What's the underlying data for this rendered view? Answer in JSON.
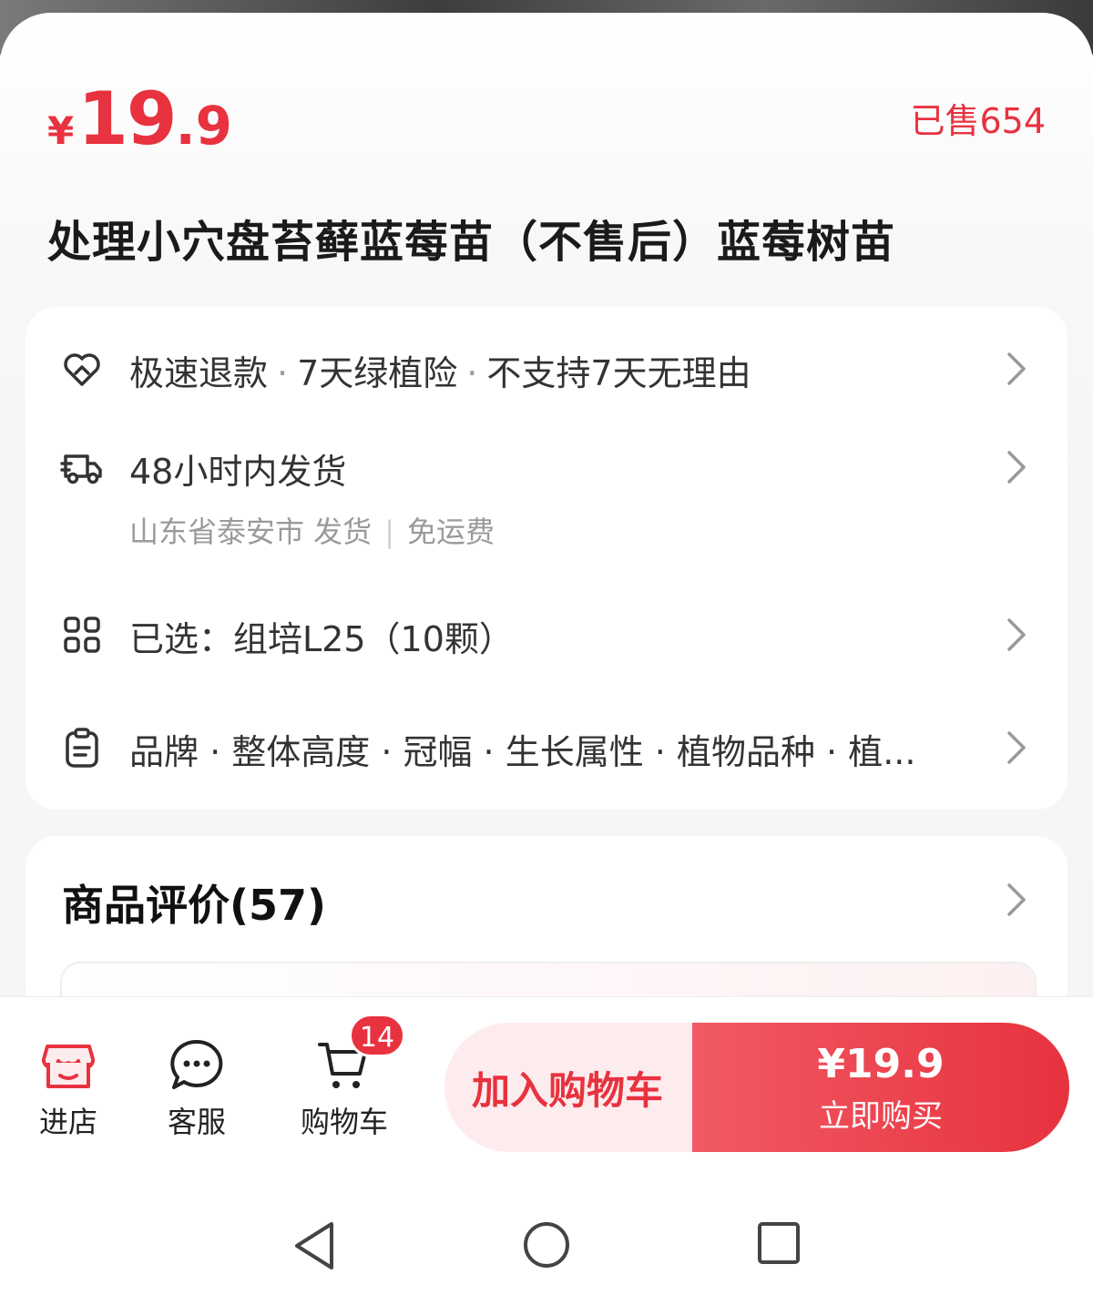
{
  "product": {
    "price_symbol": "¥",
    "price_int": "19",
    "price_dec": ".9",
    "sold": "已售654",
    "title": "处理小穴盘苔藓蓝莓苗（不售后）蓝莓树苗"
  },
  "service": {
    "guarantee": [
      "极速退款",
      "7天绿植险",
      "不支持7天无理由"
    ],
    "shipping_title": "48小时内发货",
    "shipping_origin": "山东省泰安市 发货",
    "shipping_fee": "免运费",
    "selected": "已选：组培L25（10颗）",
    "params": "品牌 · 整体高度 · 冠幅 · 生长属性 · 植物品种 · 植...",
    "icons": [
      "heart-shield-icon",
      "truck-icon",
      "grid-icon",
      "clipboard-icon",
      "chevron-right-icon"
    ]
  },
  "review": {
    "title": "商品评价(57)"
  },
  "bottom": {
    "store": "进店",
    "service": "客服",
    "cart": "购物车",
    "cart_count": "14",
    "add_cart": "加入购物车",
    "buy_price": "¥19.9",
    "buy_now": "立即购买"
  },
  "colors": {
    "accent": "#e8323f",
    "accent_light": "#fdecee"
  }
}
